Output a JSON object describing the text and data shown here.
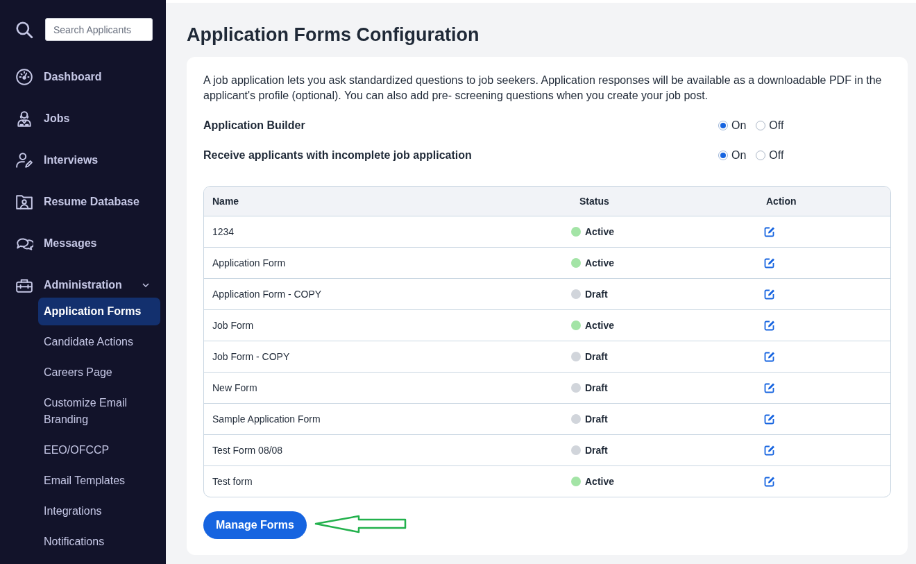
{
  "sidebar": {
    "search": {
      "placeholder": "Search Applicants"
    },
    "items": [
      {
        "kind": "dashboard",
        "label": "Dashboard"
      },
      {
        "kind": "jobs",
        "label": "Jobs"
      },
      {
        "kind": "interviews",
        "label": "Interviews"
      },
      {
        "kind": "resume",
        "label": "Resume Database"
      },
      {
        "kind": "messages",
        "label": "Messages"
      },
      {
        "kind": "administration",
        "label": "Administration",
        "expanded": true,
        "children": [
          {
            "label": "Application Forms",
            "selected": true
          },
          {
            "label": "Candidate Actions",
            "selected": false
          },
          {
            "label": "Careers Page",
            "selected": false
          },
          {
            "label": "Customize Email Branding",
            "selected": false
          },
          {
            "label": "EEO/OFCCP",
            "selected": false
          },
          {
            "label": "Email Templates",
            "selected": false
          },
          {
            "label": "Integrations",
            "selected": false
          },
          {
            "label": "Notifications",
            "selected": false
          }
        ]
      }
    ]
  },
  "page": {
    "title": "Application Forms Configuration",
    "description": "A job application lets you ask standardized questions to job seekers. Application responses will be available as a downloadable PDF in the applicant's profile (optional). You can also add pre- screening questions when you create your job post.",
    "settings": [
      {
        "label": "Application Builder",
        "options": [
          {
            "label": "On",
            "selected": true
          },
          {
            "label": "Off",
            "selected": false
          }
        ]
      },
      {
        "label": "Receive applicants with incomplete job application",
        "options": [
          {
            "label": "On",
            "selected": true
          },
          {
            "label": "Off",
            "selected": false
          }
        ]
      }
    ],
    "table": {
      "columns": [
        "Name",
        "Status",
        "Action"
      ],
      "rows": [
        {
          "name": "1234",
          "status": "Active",
          "color": "#a3e4a6"
        },
        {
          "name": "Application Form",
          "status": "Active",
          "color": "#a3e4a6"
        },
        {
          "name": "Application Form - COPY",
          "status": "Draft",
          "color": "#d1d5db"
        },
        {
          "name": "Job Form",
          "status": "Active",
          "color": "#a3e4a6"
        },
        {
          "name": "Job Form - COPY",
          "status": "Draft",
          "color": "#d1d5db"
        },
        {
          "name": "New Form",
          "status": "Draft",
          "color": "#d1d5db"
        },
        {
          "name": "Sample Application Form",
          "status": "Draft",
          "color": "#d1d5db"
        },
        {
          "name": "Test Form 08/08",
          "status": "Draft",
          "color": "#d1d5db"
        },
        {
          "name": "Test form",
          "status": "Active",
          "color": "#a3e4a6"
        }
      ]
    },
    "button": "Manage Forms"
  }
}
